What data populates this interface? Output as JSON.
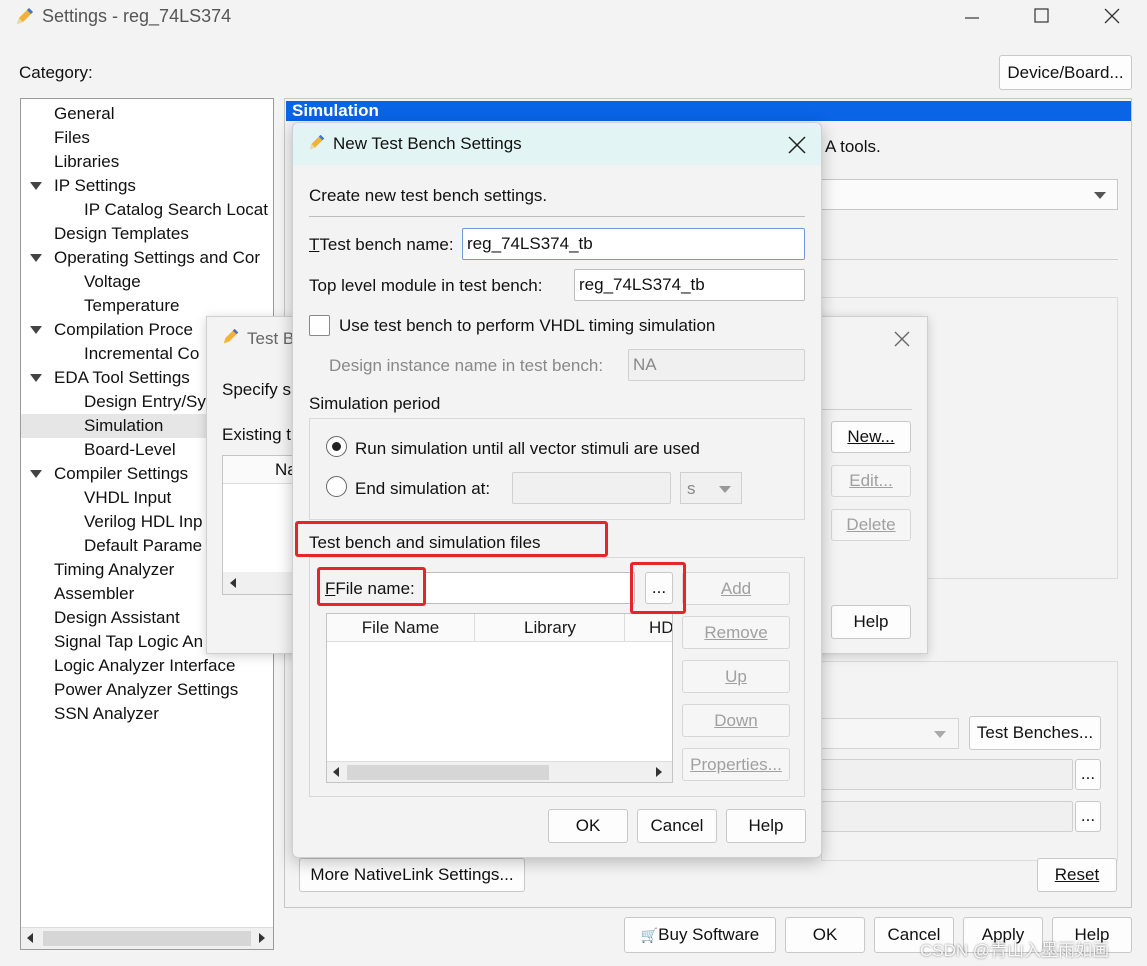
{
  "window": {
    "title": "Settings - reg_74LS374",
    "category_label": "Category:",
    "device_board_button": "Device/Board..."
  },
  "tree": [
    {
      "label": "General",
      "level": 0
    },
    {
      "label": "Files",
      "level": 0
    },
    {
      "label": "Libraries",
      "level": 0
    },
    {
      "label": "IP Settings",
      "level": 0,
      "expanded": true
    },
    {
      "label": "IP Catalog Search Locat",
      "level": 1
    },
    {
      "label": "Design Templates",
      "level": 0
    },
    {
      "label": "Operating Settings and Cor",
      "level": 0,
      "expanded": true
    },
    {
      "label": "Voltage",
      "level": 1
    },
    {
      "label": "Temperature",
      "level": 1
    },
    {
      "label": "Compilation Proce",
      "level": 0,
      "expanded": true
    },
    {
      "label": "Incremental Co",
      "level": 1
    },
    {
      "label": "EDA Tool Settings",
      "level": 0,
      "expanded": true
    },
    {
      "label": "Design Entry/Sy",
      "level": 1
    },
    {
      "label": "Simulation",
      "level": 1,
      "selected": true
    },
    {
      "label": "Board-Level",
      "level": 1
    },
    {
      "label": "Compiler Settings",
      "level": 0,
      "expanded": true
    },
    {
      "label": "VHDL Input",
      "level": 1
    },
    {
      "label": "Verilog HDL Inp",
      "level": 1
    },
    {
      "label": "Default Parame",
      "level": 1
    },
    {
      "label": "Timing Analyzer",
      "level": 0
    },
    {
      "label": "Assembler",
      "level": 0
    },
    {
      "label": "Design Assistant",
      "level": 0
    },
    {
      "label": "Signal Tap Logic An",
      "level": 0
    },
    {
      "label": "Logic Analyzer Interface",
      "level": 0
    },
    {
      "label": "Power Analyzer Settings",
      "level": 0
    },
    {
      "label": "SSN Analyzer",
      "level": 0
    }
  ],
  "simulation_panel": {
    "header": "Simulation",
    "desc_tail": "A tools.",
    "more_nativelink": "More NativeLink Settings...",
    "reset": "Reset",
    "test_benches": "Test Benches...",
    "browse": "..."
  },
  "bottom": {
    "buy_software": "Buy Software",
    "ok": "OK",
    "cancel": "Cancel",
    "apply": "Apply",
    "help": "Help"
  },
  "test_benches_dialog": {
    "title": "Test B",
    "specify": "Specify s",
    "existing": "Existing t",
    "col_name": "Na",
    "new": "New...",
    "edit": "Edit...",
    "delete": "Delete",
    "help": "Help"
  },
  "new_tb_dialog": {
    "title": "New Test Bench Settings",
    "intro": "Create new test bench settings.",
    "tb_name_label": "Test bench name:",
    "tb_name_value": "reg_74LS374_tb",
    "top_module_label": "Top level module in test bench:",
    "top_module_value": "reg_74LS374_tb",
    "vhdl_timing_label": "Use test bench to perform VHDL timing simulation",
    "vhdl_timing_checked": false,
    "instance_label": "Design instance name in test bench:",
    "instance_value": "NA",
    "sim_period_label": "Simulation period",
    "run_all_label": "Run simulation until all vector stimuli are used",
    "end_at_label": "End simulation at:",
    "end_at_value": "",
    "end_unit": "s",
    "files_label": "Test bench and simulation files",
    "file_name_label": "File name:",
    "file_name_value": "",
    "browse": "...",
    "add": "Add",
    "remove": "Remove",
    "up": "Up",
    "down": "Down",
    "properties": "Properties...",
    "columns": [
      "File Name",
      "Library",
      "HD"
    ],
    "ok": "OK",
    "cancel": "Cancel",
    "help": "Help"
  },
  "watermark": "CSDN @青山入墨雨如画",
  "colors": {
    "highlight_red": "#e8242b",
    "selection_blue": "#0a64e6",
    "dialog_title_bg": "#e3f4f4"
  }
}
